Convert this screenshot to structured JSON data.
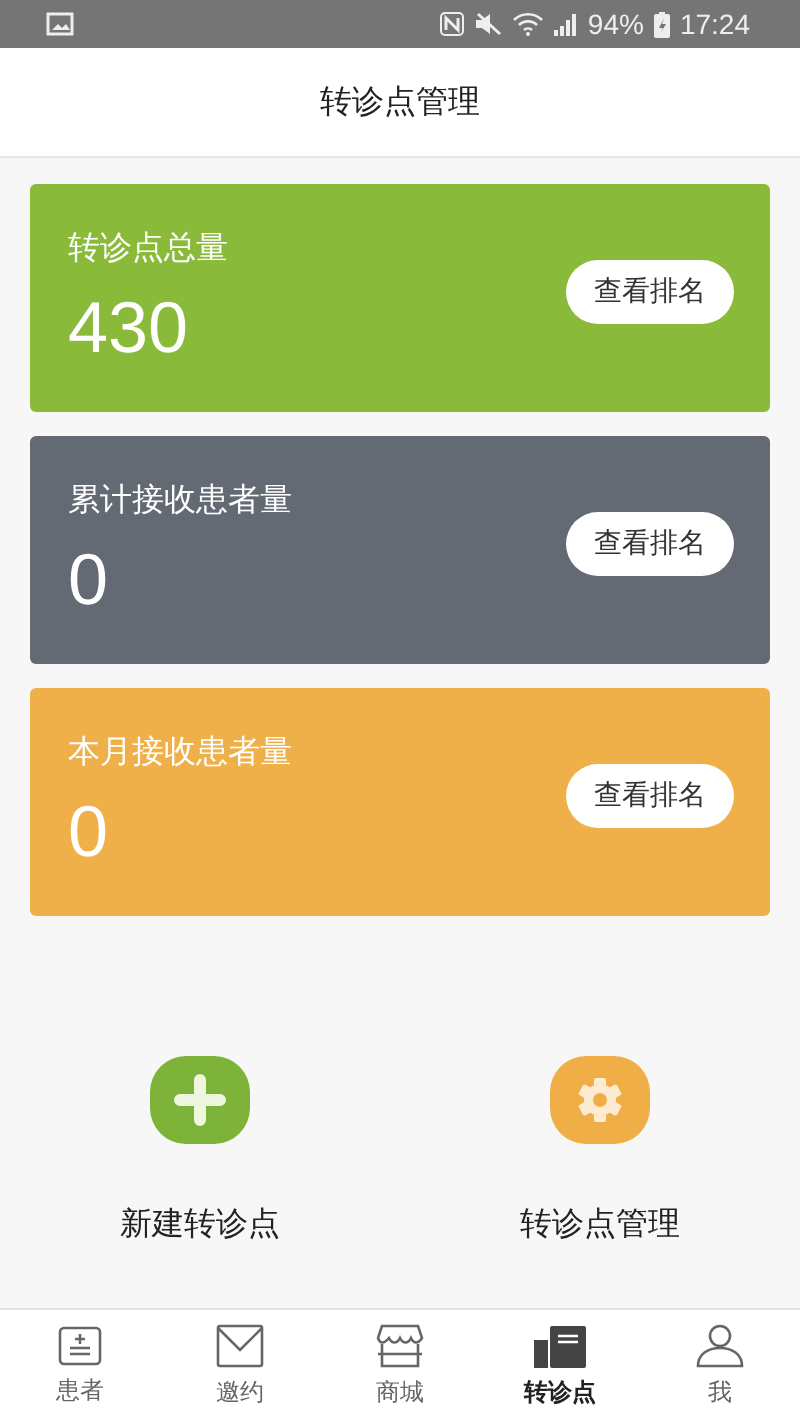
{
  "status_bar": {
    "battery": "94%",
    "time": "17:24"
  },
  "header": {
    "title": "转诊点管理"
  },
  "stat_cards": [
    {
      "label": "转诊点总量",
      "value": "430",
      "button": "查看排名",
      "color": "#8aba3a"
    },
    {
      "label": "累计接收患者量",
      "value": "0",
      "button": "查看排名",
      "color": "#636a73"
    },
    {
      "label": "本月接收患者量",
      "value": "0",
      "button": "查看排名",
      "color": "#efb04a"
    }
  ],
  "actions": [
    {
      "kind": "add",
      "label": "新建转诊点"
    },
    {
      "kind": "settings",
      "label": "转诊点管理"
    }
  ],
  "tab_bar": [
    {
      "kind": "patients",
      "label": "患者",
      "selected": false
    },
    {
      "kind": "invite",
      "label": "邀约",
      "selected": false
    },
    {
      "kind": "store",
      "label": "商城",
      "selected": false
    },
    {
      "kind": "referral",
      "label": "转诊点",
      "selected": true
    },
    {
      "kind": "me",
      "label": "我",
      "selected": false
    }
  ]
}
